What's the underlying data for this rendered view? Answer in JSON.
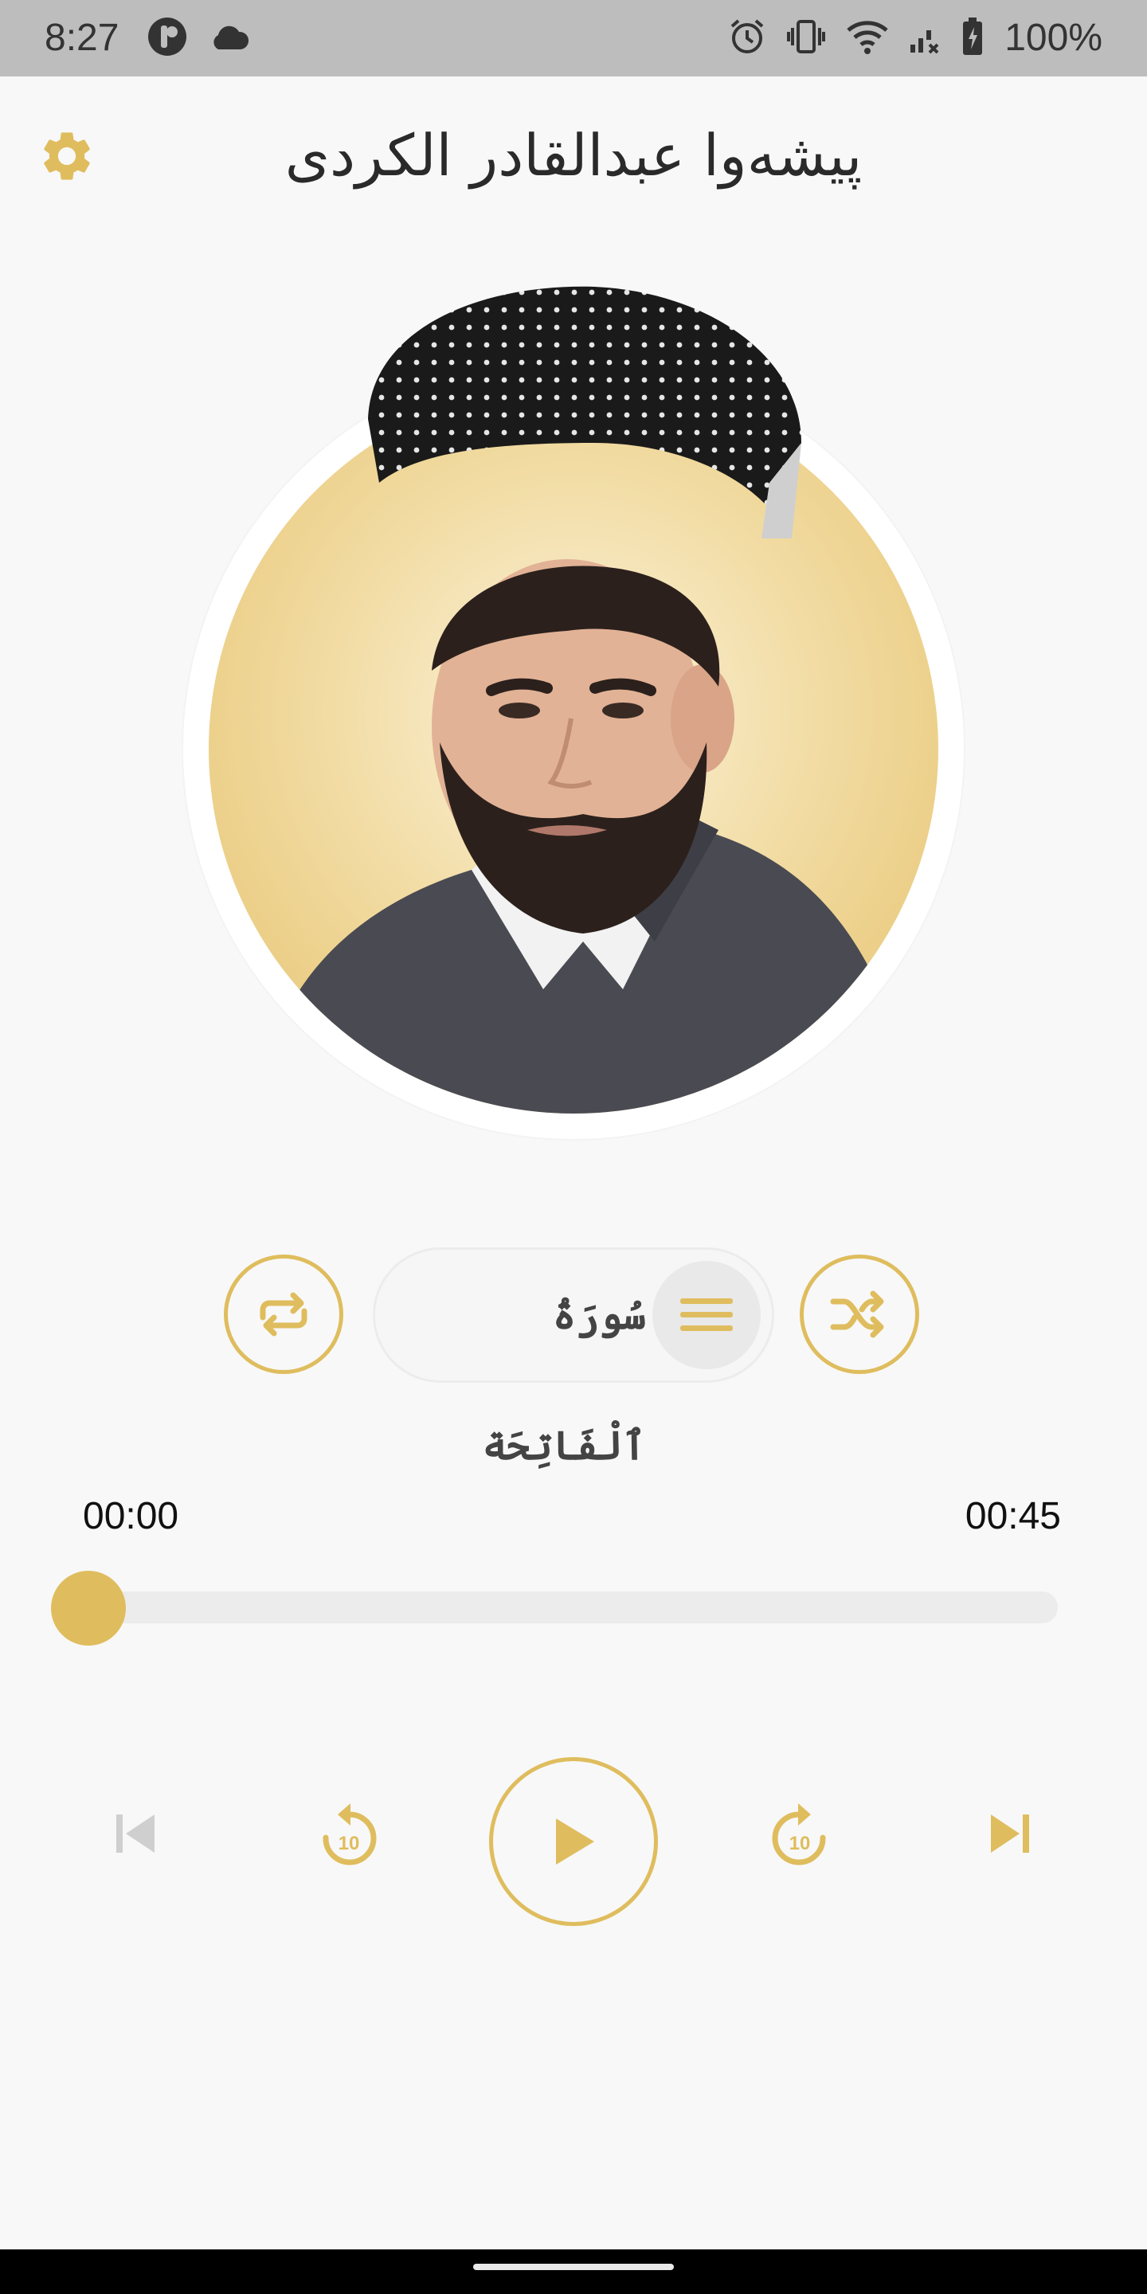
{
  "status_bar": {
    "time": "8:27",
    "battery_text": "100%",
    "icons": [
      "app-notification-icon",
      "cloud-icon",
      "alarm-icon",
      "vibrate-icon",
      "wifi-icon",
      "signal-icon",
      "battery-icon"
    ]
  },
  "header": {
    "title": "پیشەوا عبدالقادر الکردی",
    "settings_icon": "gear-icon"
  },
  "player": {
    "surah_name": "سُورَةُ ٱلْفَاتِحَة",
    "current_time": "00:00",
    "total_time": "00:45",
    "progress": 0,
    "controls": [
      "skip-previous-icon",
      "rewind-10-icon",
      "play-icon",
      "forward-10-icon",
      "skip-next-icon"
    ],
    "rewind_seconds": "10",
    "forward_seconds": "10"
  },
  "colors": {
    "accent": "#dfbd5e",
    "background": "#f8f8f8",
    "status_bar": "#bdbdbd",
    "disabled": "#cfcfcf"
  }
}
